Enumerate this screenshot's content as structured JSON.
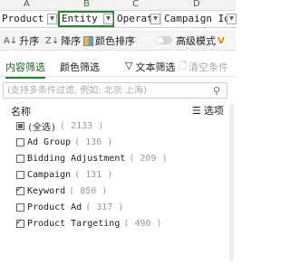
{
  "columns": [
    "A",
    "B",
    "C",
    "D"
  ],
  "header_cells": [
    "Product",
    "Entity",
    "Operat",
    "Campaign Id"
  ],
  "toolbar": {
    "asc": "升序",
    "desc": "降序",
    "color_sort": "颜色排序",
    "advanced": "高级模式",
    "advanced_badge": "V"
  },
  "tabs": {
    "content": "内容筛选",
    "color": "颜色筛选",
    "text": "文本筛选",
    "clear": "清空条件"
  },
  "search": {
    "placeholder": "(支持多条件过滤, 例如: 北京 上海)"
  },
  "list": {
    "header": "名称",
    "options": "选项",
    "items": [
      {
        "label": "(全选)",
        "count": "( 2133 )",
        "state": "partial"
      },
      {
        "label": "Ad Group",
        "count": "( 136 )",
        "state": "unchecked"
      },
      {
        "label": "Bidding Adjustment",
        "count": "( 209 )",
        "state": "unchecked"
      },
      {
        "label": "Campaign",
        "count": "( 131 )",
        "state": "unchecked"
      },
      {
        "label": "Keyword",
        "count": "( 850 )",
        "state": "checked"
      },
      {
        "label": "Product Ad",
        "count": "( 317 )",
        "state": "unchecked"
      },
      {
        "label": "Product Targeting",
        "count": "( 490 )",
        "state": "checked"
      }
    ]
  },
  "colors": {
    "accent": "#2e7d32",
    "active_header_letter": "#2e7d32"
  }
}
